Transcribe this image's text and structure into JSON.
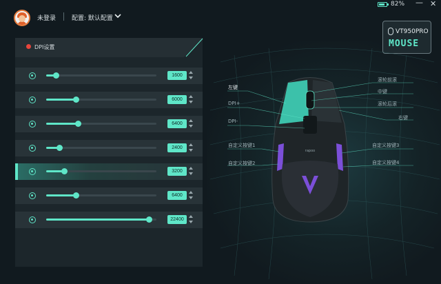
{
  "header": {
    "login_label": "未登录",
    "config_label": "配置: 默认配置",
    "battery_percent": "82%",
    "battery_level": 0.82,
    "minimize_icon": "minimize-icon",
    "close_icon": "close-icon"
  },
  "model": {
    "name": "VT950PRO",
    "type_label": "MOUSE"
  },
  "dpi": {
    "title": "DPI设置",
    "max_dpi": 26000,
    "active_index": 4,
    "levels": [
      {
        "value": "1600",
        "fraction": 0.09
      },
      {
        "value": "6000",
        "fraction": 0.27
      },
      {
        "value": "6400",
        "fraction": 0.29
      },
      {
        "value": "2400",
        "fraction": 0.12
      },
      {
        "value": "3200",
        "fraction": 0.16
      },
      {
        "value": "6400",
        "fraction": 0.27
      },
      {
        "value": "22400",
        "fraction": 0.93
      }
    ]
  },
  "mouse_labels": {
    "left_button": "左键",
    "dpi_plus": "DPI+",
    "dpi_minus": "DPI-",
    "custom_1": "自定义按键1",
    "custom_2": "自定义按键2",
    "scroll_forward": "滚轮前滚",
    "middle": "中键",
    "scroll_back": "滚轮后滚",
    "right_button": "右键",
    "custom_3": "自定义按键3",
    "custom_4": "自定义按键4",
    "brand_text": "rapoo"
  },
  "colors": {
    "accent": "#5fe6c8",
    "status_dot": "#e8453c",
    "panel": "#1c262b",
    "background": "#111a1f"
  }
}
